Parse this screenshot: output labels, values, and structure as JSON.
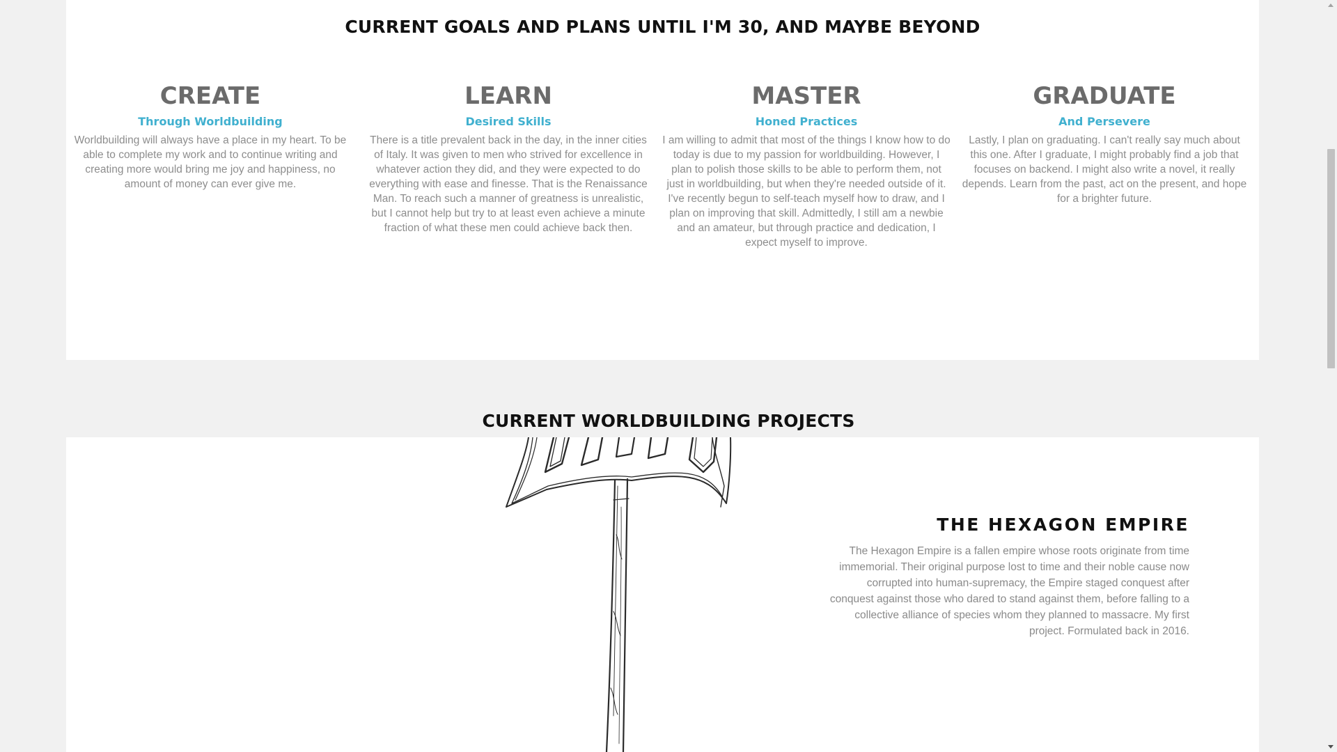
{
  "goals": {
    "title": "CURRENT GOALS AND PLANS UNTIL I'M 30, AND MAYBE BEYOND",
    "items": [
      {
        "heading": "CREATE",
        "subheading": "Through Worldbuilding",
        "text": "Worldbuilding will always have a place in my heart. To be able to complete my work and to continue writing and creating more would bring me joy and happiness, no amount of money can ever give me."
      },
      {
        "heading": "LEARN",
        "subheading": "Desired Skills",
        "text": "There is a title prevalent back in the day, in the inner cities of Italy. It was given to men who strived for excellence in whatever action they did, and they were expected to do everything with ease and finesse. That is the Renaissance Man. To reach such a manner of greatness is unrealistic, but I cannot help but try to at least even achieve a minute fraction of what these men could achieve back then."
      },
      {
        "heading": "MASTER",
        "subheading": "Honed Practices",
        "text": "I am willing to admit that most of the things I know how to do today is due to my passion for worldbuilding. However, I plan to polish those skills to be able to perform them, not just in worldbuilding, but when they're needed outside of it. I've recently begun to self-teach myself how to draw, and I plan on improving that skill. Admittedly, I still am a newbie and an amateur, but through practice and dedication, I expect myself to improve."
      },
      {
        "heading": "GRADUATE",
        "subheading": "And Persevere",
        "text": "Lastly, I plan on graduating. I can't really say much about this one. After I graduate, I might probably find a job that focuses on backend. I might also write a novel, it really depends. Learn from the past, act on the present, and hope for a brighter future."
      }
    ]
  },
  "projects": {
    "title": "CURRENT WORLDBUILDING PROJECTS",
    "featured": {
      "name": "THE HEXAGON EMPIRE",
      "description": "The Hexagon Empire is a fallen empire whose roots originate from time immemorial. Their original purpose lost to time and their noble cause now corrupted into human-supremacy, the Empire staged conquest after conquest against those who dared to stand against them, before falling to a collective alliance of species whom they planned to massacre. My first project. Formulated back in 2016."
    }
  },
  "colors": {
    "accent": "#40b0cf",
    "heading_gray": "#6b6b6b",
    "body_gray": "#8d8d8d",
    "background": "#f1f1f1"
  }
}
